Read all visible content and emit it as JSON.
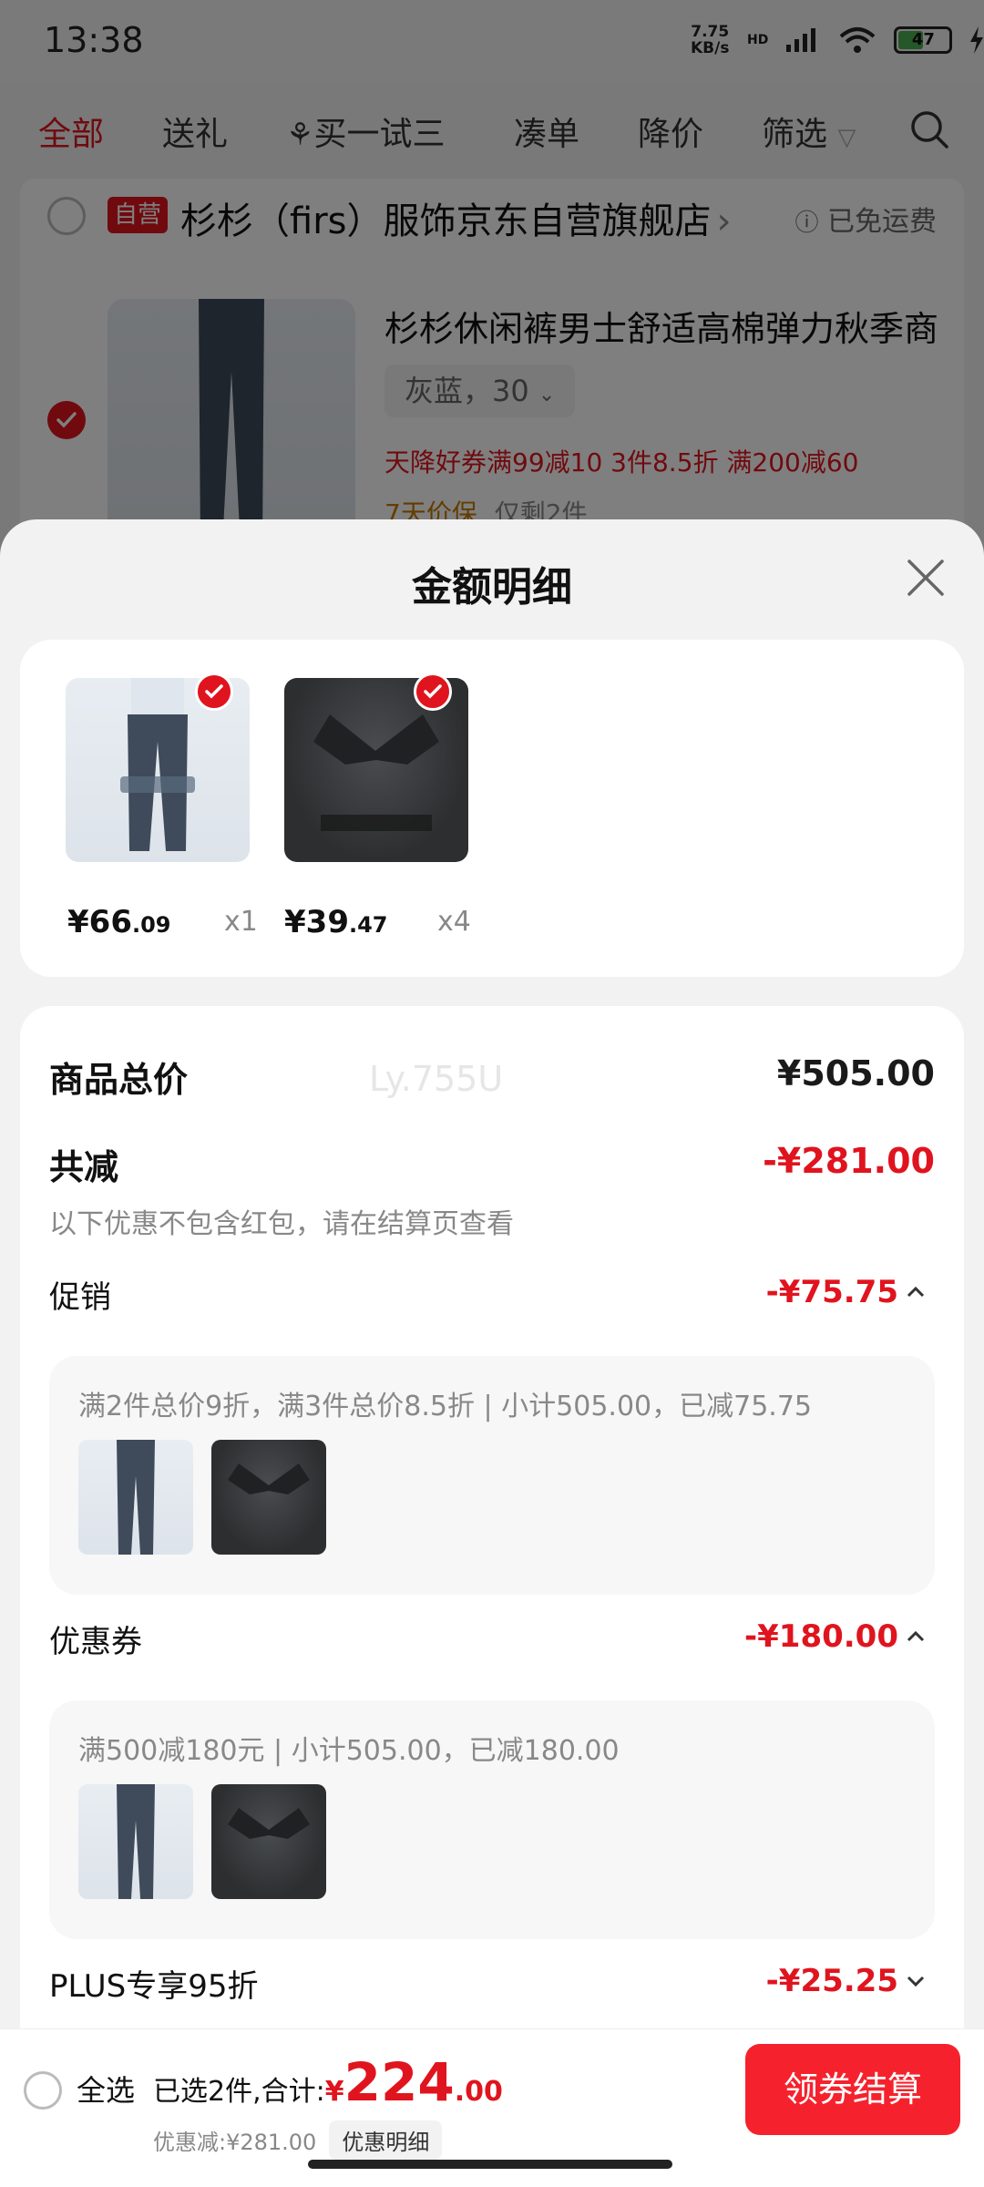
{
  "status_bar": {
    "time": "13:38",
    "speed": "7.75",
    "speed_unit": "KB/s",
    "network": "HD",
    "battery": "47"
  },
  "top_tabs": [
    "全部",
    "送礼",
    "买一试三",
    "凑单",
    "降价",
    "筛选"
  ],
  "shop": {
    "badge": "自营",
    "name": "杉杉（firs）服饰京东自营旗舰店",
    "chevron": "›",
    "free_shipping": "已免运费"
  },
  "background_product": {
    "title": "杉杉休闲裤男士舒适高棉弹力秋季商",
    "spec": "灰蓝，30",
    "promos": "天降好券满99减10  3件8.5折  满200减60",
    "guarantee": "7天价保",
    "stock": "仅剩2件"
  },
  "sheet": {
    "title": "金额明细",
    "items": [
      {
        "price_main": "¥66",
        "price_cents": ".09",
        "qty": "x1"
      },
      {
        "price_main": "¥39",
        "price_cents": ".47",
        "qty": "x4"
      }
    ],
    "watermark": "Ly.755U",
    "total_label": "商品总价",
    "total_value": "¥505.00",
    "reduce_label": "共减",
    "reduce_value": "-¥281.00",
    "reduce_note": "以下优惠不包含红包，请在结算页查看",
    "promo": {
      "label": "促销",
      "value": "-¥75.75",
      "detail": "满2件总价9折，满3件总价8.5折 | 小计505.00，已减75.75"
    },
    "coupon": {
      "label": "优惠券",
      "value": "-¥180.00",
      "detail": "满500减180元 | 小计505.00，已减180.00"
    },
    "plus": {
      "label": "PLUS专享95折",
      "value": "-¥25.25"
    }
  },
  "bottom_bar": {
    "select_all": "全选",
    "selected_text": "已选2件,合计:",
    "currency": "¥",
    "total_int": "224",
    "total_dec": ".00",
    "discount_text": "优惠减:¥281.00",
    "detail_button": "优惠明细",
    "checkout_button": "领券结算"
  },
  "colors": {
    "accent_red": "#e0141e",
    "checkout_red": "#f5222d"
  }
}
